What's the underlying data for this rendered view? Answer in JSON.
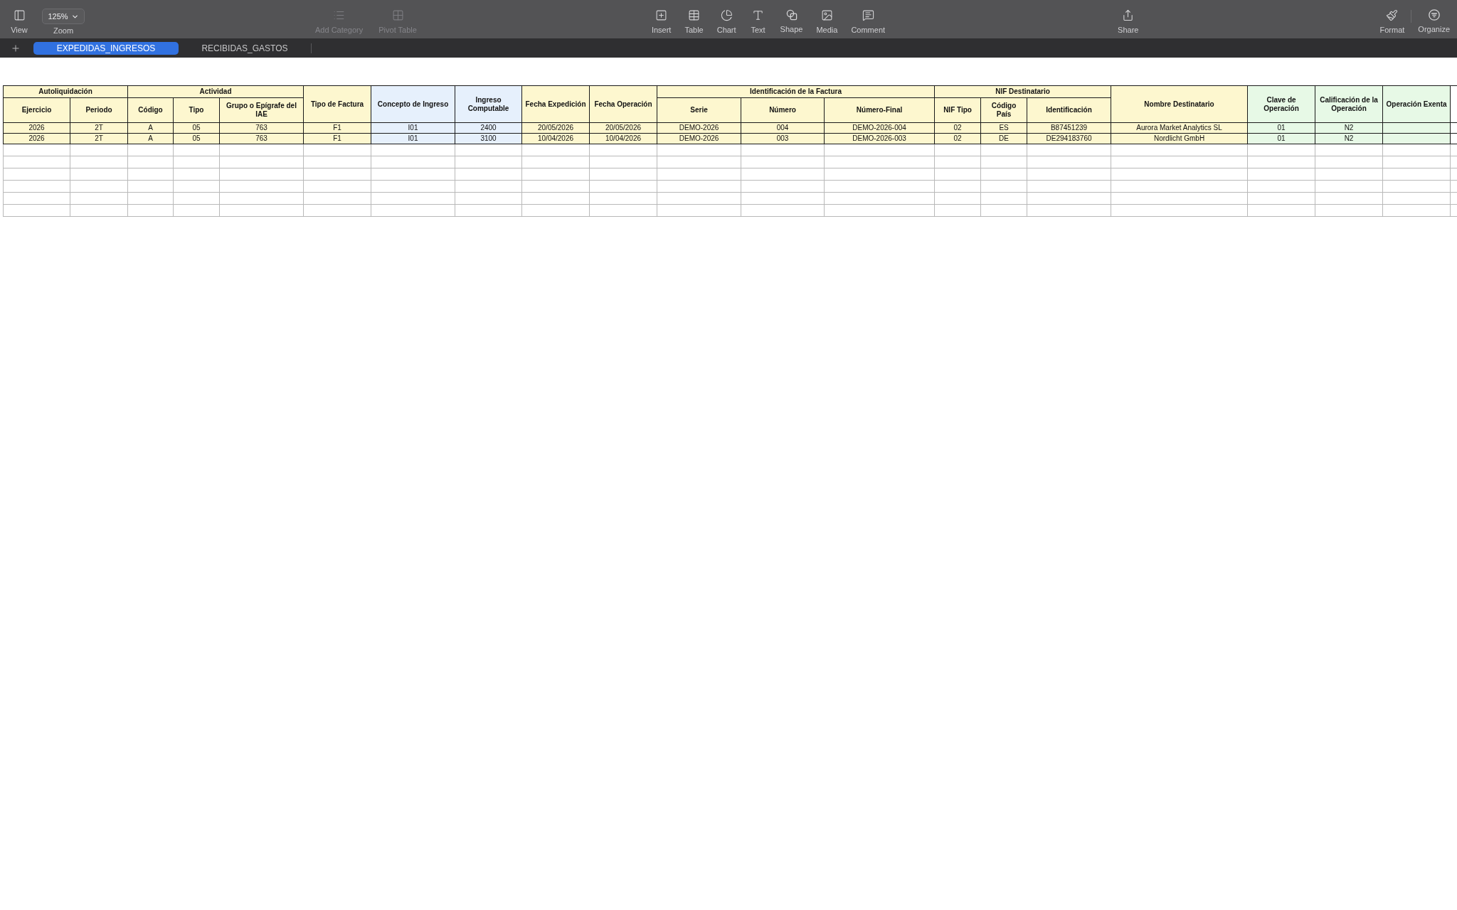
{
  "toolbar": {
    "left": [
      {
        "kind": "button",
        "label": "View",
        "disabled": false
      },
      {
        "kind": "dropdown",
        "label": "Zoom",
        "value": "125%",
        "disabled": false
      }
    ],
    "data_tools": [
      {
        "label": "Add Category",
        "disabled": true
      },
      {
        "label": "Pivot Table",
        "disabled": true
      }
    ],
    "insert_tools": [
      {
        "label": "Insert",
        "disabled": false
      },
      {
        "label": "Table",
        "disabled": false
      },
      {
        "label": "Chart",
        "disabled": false
      },
      {
        "label": "Text",
        "disabled": false
      },
      {
        "label": "Shape",
        "disabled": false
      },
      {
        "label": "Media",
        "disabled": false
      },
      {
        "label": "Comment",
        "disabled": false
      }
    ],
    "share": [
      {
        "label": "Share",
        "disabled": false
      }
    ],
    "right": [
      {
        "label": "Format",
        "disabled": false
      },
      {
        "label": "Organize",
        "disabled": false
      }
    ]
  },
  "sheet_tabs": [
    {
      "label": "EXPEDIDAS_INGRESOS",
      "selected": true
    },
    {
      "label": "RECIBIDAS_GASTOS",
      "selected": false
    }
  ],
  "table": {
    "header": [
      {
        "label": "Autoliquidación",
        "color": "#fdf7cf",
        "children": [
          {
            "label": "Ejercicio"
          },
          {
            "label": "Periodo"
          }
        ]
      },
      {
        "label": "Actividad",
        "color": "#fdf7cf",
        "children": [
          {
            "label": "Código"
          },
          {
            "label": "Tipo"
          },
          {
            "label": "Grupo o Epígrafe del IAE"
          }
        ]
      },
      {
        "label": "Tipo de Factura",
        "color": "#fdf7cf"
      },
      {
        "label": "Concepto de Ingreso",
        "color": "#e6f0fc"
      },
      {
        "label": "Ingreso Computable",
        "color": "#e6f0fc"
      },
      {
        "label": "Fecha Expedición",
        "color": "#fdf7cf"
      },
      {
        "label": "Fecha Operación",
        "color": "#fdf7cf"
      },
      {
        "label": "Identificación de la Factura",
        "color": "#fdf7cf",
        "children": [
          {
            "label": "Serie"
          },
          {
            "label": "Número"
          },
          {
            "label": "Número-Final"
          }
        ]
      },
      {
        "label": "NIF Destinatario",
        "color": "#fdf7cf",
        "children": [
          {
            "label": "NIF Tipo"
          },
          {
            "label": "Código País"
          },
          {
            "label": "Identificación"
          }
        ]
      },
      {
        "label": "Nombre Destinatario",
        "color": "#fdf7cf"
      },
      {
        "label": "Clave de Operación",
        "color": "#e7f9e6"
      },
      {
        "label": "Calificación de la Operación",
        "color": "#e7f9e6"
      },
      {
        "label": "Operación Exenta",
        "color": "#e7f9e6"
      }
    ],
    "rows": [
      [
        "2026",
        "2T",
        "A",
        "05",
        "763",
        "F1",
        "I01",
        "2400",
        "20/05/2026",
        "20/05/2026",
        "DEMO-2026",
        "004",
        "DEMO-2026-004",
        "02",
        "ES",
        "B87451239",
        "Aurora Market Analytics SL",
        "01",
        "N2"
      ],
      [
        "2026",
        "2T",
        "A",
        "05",
        "763",
        "F1",
        "I01",
        "3100",
        "10/04/2026",
        "10/04/2026",
        "DEMO-2026",
        "003",
        "DEMO-2026-003",
        "02",
        "DE",
        "DE294183760",
        "Nordlicht GmbH",
        "01",
        "N2"
      ]
    ]
  }
}
